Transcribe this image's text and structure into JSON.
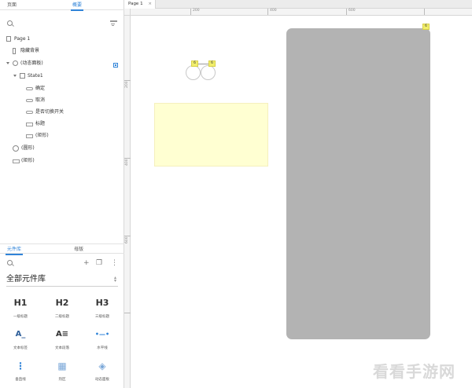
{
  "left_panel": {
    "top_tabs": {
      "pages": "页面",
      "outline": "概要"
    },
    "tree": {
      "page": "Page 1",
      "items": [
        {
          "label": "隐藏背景"
        },
        {
          "label": "(动态面板)"
        },
        {
          "label": "State1"
        },
        {
          "label": "确定"
        },
        {
          "label": "取消"
        },
        {
          "label": "是否切换开关"
        },
        {
          "label": "标题"
        },
        {
          "label": "(矩形)"
        },
        {
          "label": "(圆形)"
        },
        {
          "label": "(矩形)"
        }
      ]
    },
    "bottom_tabs": {
      "library": "元件库",
      "masters": "母版"
    },
    "library_toolbar": {
      "add": "+",
      "copy": "❐",
      "more": "⋮"
    },
    "library_select": {
      "value": "全部元件库"
    },
    "widgets": [
      {
        "glyph": "H1",
        "label": "一级标题"
      },
      {
        "glyph": "H2",
        "label": "二级标题"
      },
      {
        "glyph": "H3",
        "label": "三级标题"
      },
      {
        "glyph": "A_",
        "label": "文本标签"
      },
      {
        "glyph": "A≡",
        "label": "文本段落"
      },
      {
        "glyph": "•—•",
        "label": "水平线"
      },
      {
        "glyph": "⋮",
        "label": "垂直线"
      },
      {
        "glyph": "▦",
        "label": "热区"
      },
      {
        "glyph": "◈",
        "label": "动态面板"
      }
    ]
  },
  "canvas": {
    "doc_tab": "Page 1",
    "doc_tab_close": "×",
    "ruler_h": [
      "200",
      "400",
      "600"
    ],
    "ruler_v": [
      "200",
      "400",
      "600"
    ],
    "markers": [
      "6",
      "6",
      "6"
    ]
  },
  "watermark": "看看手游网"
}
